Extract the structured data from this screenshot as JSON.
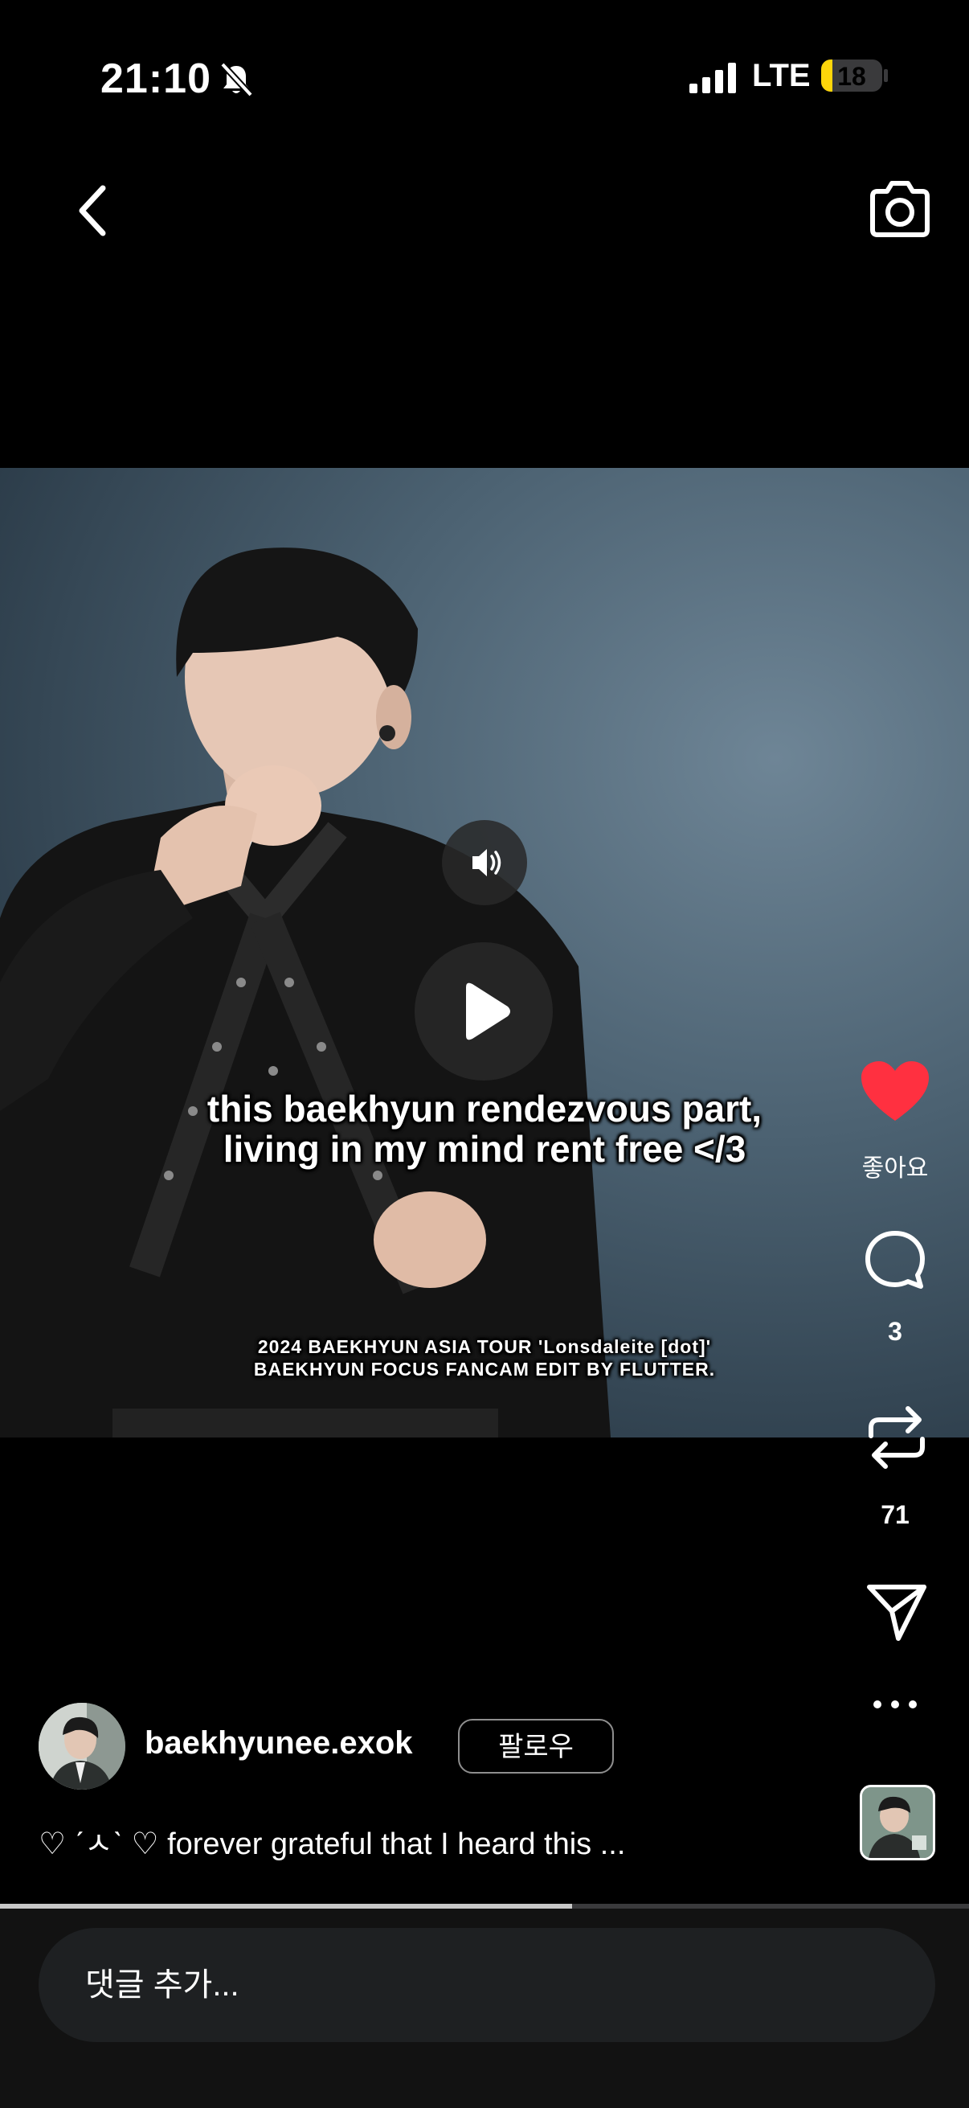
{
  "status_bar": {
    "time": "21:10",
    "network": "LTE",
    "battery": "18",
    "battery_level_percent": 18
  },
  "video": {
    "caption_line1": "this baekhyun rendezvous part,",
    "caption_line2": "living in my mind rent free </3",
    "credit_line1": "2024 BAEKHYUN ASIA TOUR 'Lonsdaleite [dot]'",
    "credit_line2": "BAEKHYUN FOCUS FANCAM EDIT BY FLUTTER.",
    "progress_fraction": 0.59
  },
  "actions": {
    "like_label": "좋아요",
    "comment_count": "3",
    "repost_count": "71",
    "like_color": "#ff3040"
  },
  "post": {
    "username": "baekhyunee.exok",
    "follow_label": "팔로우",
    "caption": "♡ ˊㅅˋ ♡ forever grateful that I heard this ..."
  },
  "comment_box": {
    "placeholder": "댓글 추가..."
  }
}
